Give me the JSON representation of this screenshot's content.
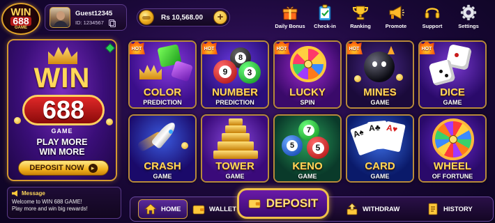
{
  "brand": {
    "line1": "WIN",
    "line2": "688",
    "line3": "GAME"
  },
  "profile": {
    "username": "Guest12345",
    "id_text": "ID: 1234567"
  },
  "balance": {
    "amount": "Rs 10,568.00",
    "add_symbol": "+"
  },
  "top_nav": [
    {
      "label": "Daily Bonus",
      "icon": "gift-icon"
    },
    {
      "label": "Check-in",
      "icon": "clipboard-check-icon"
    },
    {
      "label": "Ranking",
      "icon": "trophy-icon"
    },
    {
      "label": "Promote",
      "icon": "megaphone-icon"
    },
    {
      "label": "Support",
      "icon": "headset-icon"
    },
    {
      "label": "Settings",
      "icon": "gear-icon"
    }
  ],
  "promo": {
    "win": "WIN",
    "number": "688",
    "game": "GAME",
    "slogan_line1": "PLAY MORE",
    "slogan_line2": "WIN MORE",
    "button": "DEPOSIT NOW"
  },
  "hot_label": "HOT",
  "games": [
    {
      "title": "COLOR",
      "subtitle": "PREDICTION",
      "hot": true
    },
    {
      "title": "NUMBER",
      "subtitle": "PREDICTION",
      "hot": true
    },
    {
      "title": "LUCKY",
      "subtitle": "SPIN",
      "hot": true
    },
    {
      "title": "MINES",
      "subtitle": "GAME",
      "hot": true
    },
    {
      "title": "DICE",
      "subtitle": "GAME",
      "hot": true
    },
    {
      "title": "CRASH",
      "subtitle": "GAME",
      "hot": false
    },
    {
      "title": "TOWER",
      "subtitle": "GAME",
      "hot": false
    },
    {
      "title": "KENO",
      "subtitle": "GAME",
      "hot": false
    },
    {
      "title": "CARD",
      "subtitle": "GAME",
      "hot": false
    },
    {
      "title": "WHEEL",
      "subtitle": "OF FORTUNE",
      "hot": false
    }
  ],
  "ball_numbers": {
    "number_tile": [
      "8",
      "9",
      "3"
    ],
    "keno_tile": [
      "7",
      "5",
      "5"
    ]
  },
  "message": {
    "title": "Message",
    "line1": "Welcome to WIN 688 GAME!",
    "line2": "Play more and win big rewards!"
  },
  "bottom_nav": {
    "home": "HOME",
    "wallet": "WALLET",
    "deposit": "DEPOSIT",
    "withdraw": "WITHDRAW",
    "history": "HISTORY"
  },
  "colors": {
    "gold": "#ffd85a",
    "purple_bg": "#1a0838",
    "border_gold": "#d59a30",
    "hot_red": "#d81a10"
  }
}
